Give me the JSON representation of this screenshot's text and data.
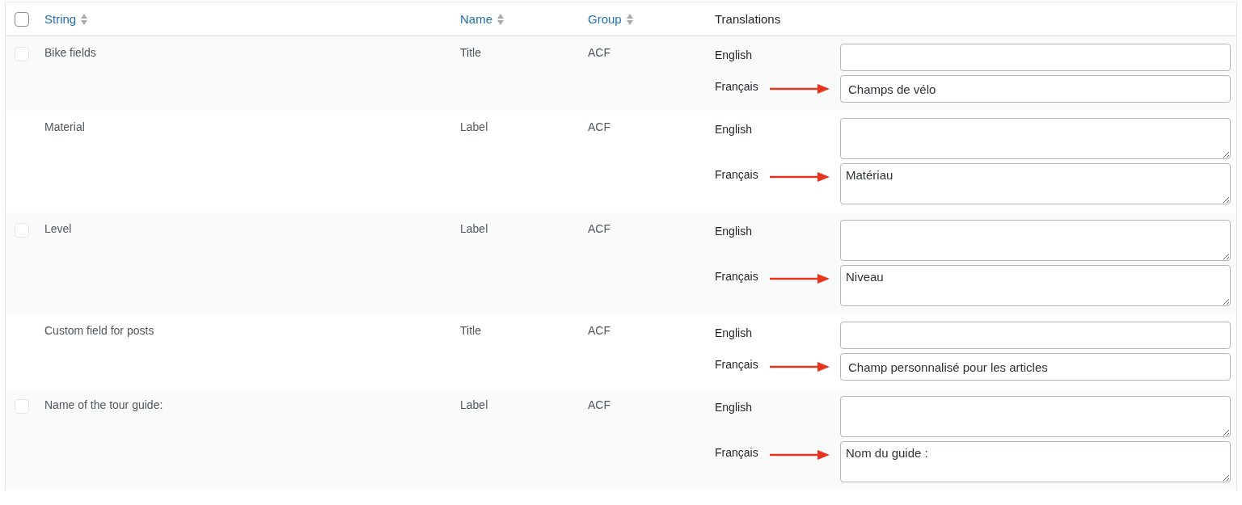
{
  "table": {
    "select_all": {
      "checked": false
    },
    "columns": [
      {
        "label": "String",
        "sortable": true
      },
      {
        "label": "Name",
        "sortable": true
      },
      {
        "label": "Group",
        "sortable": true
      },
      {
        "label": "Translations",
        "sortable": false
      }
    ],
    "rows": [
      {
        "checkbox": {
          "checked": false
        },
        "string": "Bike fields",
        "name": "Title",
        "group": "ACF",
        "translations": [
          {
            "language": "English",
            "kind": "input",
            "marked": false
          },
          {
            "language": "Français",
            "kind": "input",
            "value": "Champs de vélo",
            "marked": true
          }
        ]
      },
      {
        "string": "Material",
        "name": "Label",
        "group": "ACF",
        "translations": [
          {
            "language": "English",
            "kind": "textarea",
            "marked": false
          },
          {
            "language": "Français",
            "kind": "textarea",
            "value": "Matériau",
            "marked": true
          }
        ]
      },
      {
        "checkbox": {
          "checked": false
        },
        "string": "Level",
        "name": "Label",
        "group": "ACF",
        "translations": [
          {
            "language": "English",
            "kind": "textarea",
            "marked": false
          },
          {
            "language": "Français",
            "kind": "textarea",
            "value": "Niveau",
            "marked": true
          }
        ]
      },
      {
        "string": "Custom field for posts",
        "name": "Title",
        "group": "ACF",
        "translations": [
          {
            "language": "English",
            "kind": "input",
            "marked": false
          },
          {
            "language": "Français",
            "kind": "input",
            "value": "Champ personnalisé pour les articles",
            "marked": true
          }
        ]
      },
      {
        "checkbox": {
          "checked": false
        },
        "string": "Name of the tour guide:",
        "name": "Label",
        "group": "ACF",
        "translations": [
          {
            "language": "English",
            "kind": "textarea",
            "marked": false
          },
          {
            "language": "Français",
            "kind": "textarea",
            "value": "Nom du guide :",
            "marked": true
          }
        ]
      }
    ]
  }
}
